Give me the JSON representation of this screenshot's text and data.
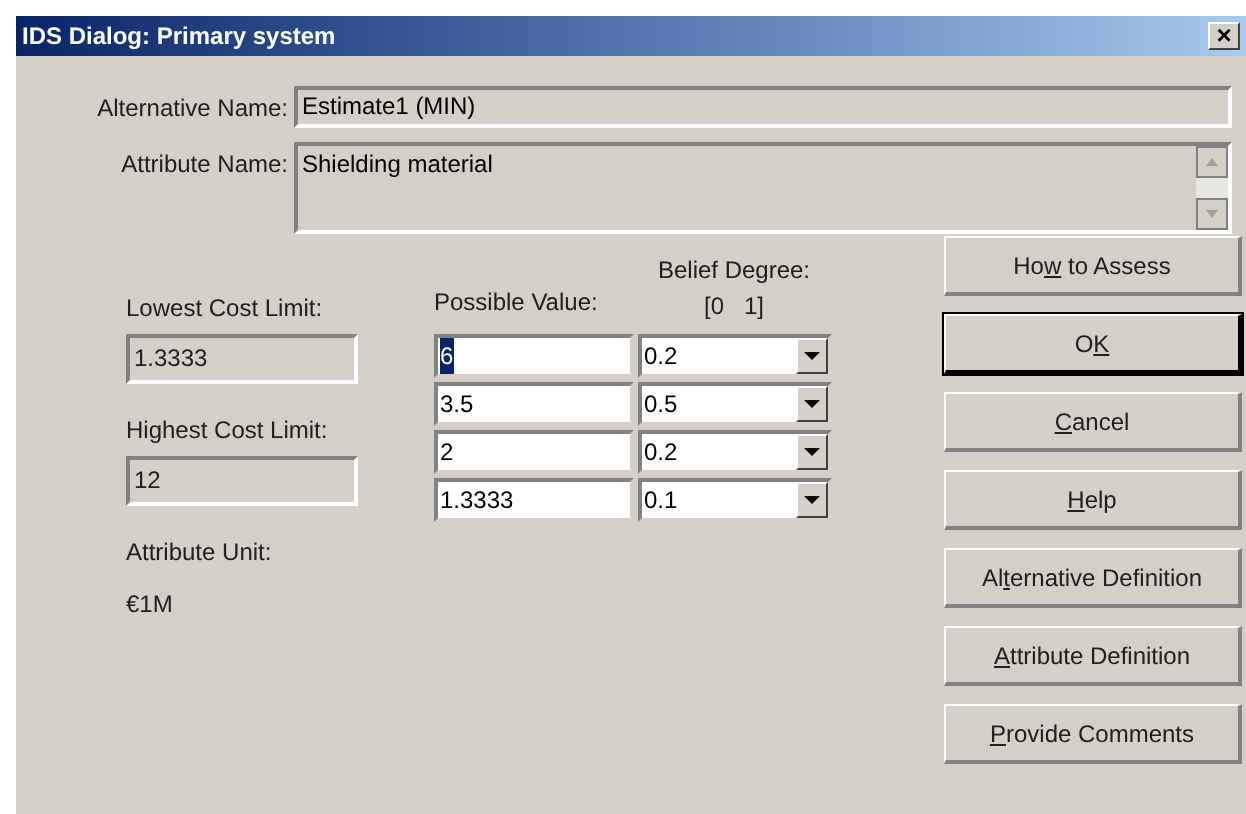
{
  "window": {
    "title": "IDS Dialog: Primary system",
    "close": "×"
  },
  "alternative_name": {
    "label": "Alternative Name:",
    "value": "Estimate1 (MIN)"
  },
  "attribute_name": {
    "label": "Attribute Name:",
    "value": "Shielding material"
  },
  "lowest_cost": {
    "label": "Lowest Cost Limit:",
    "value": "1.3333"
  },
  "highest_cost": {
    "label": "Highest Cost Limit:",
    "value": "12"
  },
  "attribute_unit": {
    "label": "Attribute Unit:",
    "value": "€1M"
  },
  "grid": {
    "value_header": "Possible Value:",
    "belief_header": "Belief Degree:",
    "belief_range": "[0   1]",
    "rows": [
      {
        "value": "6",
        "belief": "0.2",
        "text_selected": true
      },
      {
        "value": "3.5",
        "belief": "0.5",
        "text_selected": false
      },
      {
        "value": "2",
        "belief": "0.2",
        "text_selected": false
      },
      {
        "value": "1.3333",
        "belief": "0.1",
        "text_selected": false
      }
    ]
  },
  "buttons": [
    {
      "label_start": "Ho",
      "mnemonic": "w",
      "label_end": " to Assess",
      "default": false
    },
    {
      "label_start": "O",
      "mnemonic": "K",
      "default": true
    },
    {
      "mnemonic": "C",
      "label_end": "ancel",
      "default": false
    },
    {
      "mnemonic": "H",
      "label_end": "elp",
      "default": false
    },
    {
      "label_start": "Al",
      "mnemonic": "t",
      "label_end": "ernative Definition",
      "default": false
    },
    {
      "mnemonic": "A",
      "label_end": "ttribute Definition",
      "default": false
    },
    {
      "mnemonic": "P",
      "label_end": "rovide Comments",
      "default": false
    }
  ]
}
